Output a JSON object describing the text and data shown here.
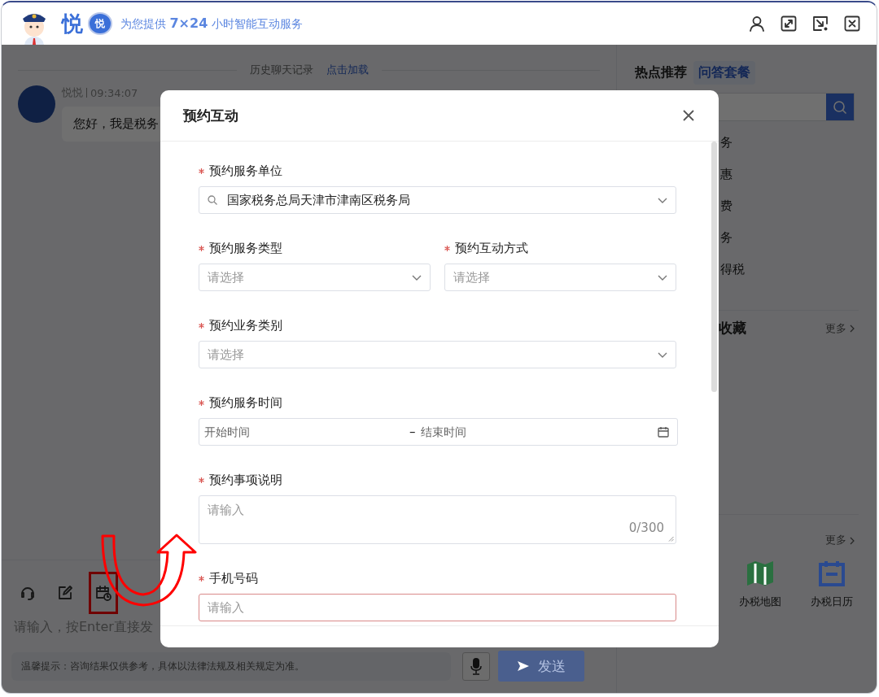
{
  "header": {
    "logo_text": "悦",
    "badge_text": "悦",
    "slogan": "为您提供 **7×24** 小时智能互动服务"
  },
  "chat": {
    "history_label": "历史聊天记录",
    "history_link": "点击加载",
    "messages": [
      {
        "sender": "悦悦",
        "time": "09:34:07",
        "text": "您好，我是税务"
      }
    ],
    "toolbar": [
      {
        "kind": "headset",
        "highlighted": false
      },
      {
        "kind": "edit",
        "highlighted": false
      },
      {
        "kind": "appointment",
        "highlighted": true
      }
    ],
    "input": {
      "placeholder": "请输入，按Enter直接发"
    },
    "tip": "温馨提示：咨询结果仅供参考，具体以法律法规及相关规定为准。",
    "send": {
      "label": "发送",
      "disabled": true
    }
  },
  "side": {
    "tabs": [
      {
        "label": "热点推荐",
        "selected": false
      },
      {
        "label": "问答套餐",
        "selected": true
      }
    ],
    "hot_items": [
      "务",
      "惠",
      "费",
      "务",
      "得税"
    ],
    "favorites": {
      "title": "收藏",
      "more": "更多"
    },
    "tools": {
      "more": "更多",
      "items": [
        {
          "label": "办税地图",
          "kind": "map",
          "color": "#2a7040"
        },
        {
          "label": "办税日历",
          "kind": "calendar",
          "color": "#2a4a90"
        }
      ]
    }
  },
  "modal": {
    "title": "预约互动",
    "rows": [
      [
        {
          "label": "预约服务单位",
          "required": true,
          "kind": "select",
          "searchable": true,
          "value": "国家税务总局天津市津南区税务局"
        }
      ],
      [
        {
          "label": "预约服务类型",
          "required": true,
          "kind": "select",
          "placeholder": "请选择"
        },
        {
          "label": "预约互动方式",
          "required": true,
          "kind": "select",
          "placeholder": "请选择"
        }
      ],
      [
        {
          "label": "预约业务类别",
          "required": true,
          "kind": "select",
          "placeholder": "请选择"
        }
      ],
      [
        {
          "label": "预约服务时间",
          "required": true,
          "kind": "daterange",
          "start_placeholder": "开始时间",
          "separator": "–",
          "end_placeholder": "结束时间"
        }
      ],
      [
        {
          "label": "预约事项说明",
          "required": true,
          "kind": "textarea",
          "placeholder": "请输入",
          "counter": "0/300"
        }
      ],
      [
        {
          "label": "手机号码",
          "required": true,
          "kind": "input",
          "placeholder": "请输入",
          "error": true
        }
      ]
    ]
  }
}
